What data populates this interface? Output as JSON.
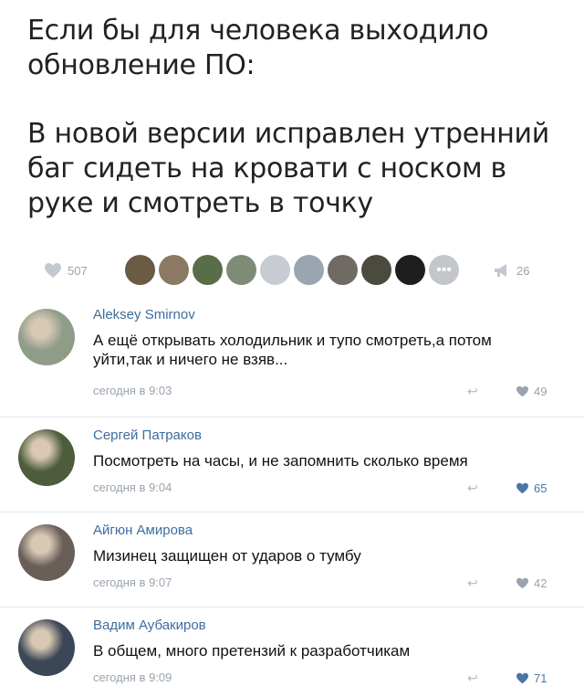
{
  "post": {
    "line1": "Если бы для человека выходило обновление ПО:",
    "line2": "В новой версии исправлен утренний баг сидеть на кровати с носком в руке и смотреть в точку"
  },
  "stats": {
    "likes": "507",
    "shares": "26",
    "like_icon": "heart-icon",
    "share_icon": "megaphone-icon",
    "avatar_colors": [
      "#6b5a44",
      "#8a7a63",
      "#5a6d49",
      "#7e8c76",
      "#c7ccd2",
      "#9aa5b0",
      "#6f6a64",
      "#4a4a3f",
      "#1e1e1e",
      "#c3c7cc"
    ]
  },
  "comments": [
    {
      "name": "Aleksey Smirnov",
      "text": "А ещё открывать холодильник и тупо смотреть,а потом уйти,так и ничего не взяв...",
      "time": "сегодня в 9:03",
      "likes": "49",
      "liked": false,
      "avatar_color": "#8e9c88"
    },
    {
      "name": "Сергей Патраков",
      "text": "Посмотреть на часы, и не запомнить сколько время",
      "time": "сегодня в 9:04",
      "likes": "65",
      "liked": true,
      "avatar_color": "#4d5d3b"
    },
    {
      "name": "Айгюн Амирова",
      "text": "Мизинец защищен от ударов о тумбу",
      "time": "сегодня в 9:07",
      "likes": "42",
      "liked": false,
      "avatar_color": "#6a5e58"
    },
    {
      "name": "Вадим Аубакиров",
      "text": "В общем, много претензий к разработчикам",
      "time": "сегодня в 9:09",
      "likes": "71",
      "liked": true,
      "avatar_color": "#3b4756"
    }
  ]
}
